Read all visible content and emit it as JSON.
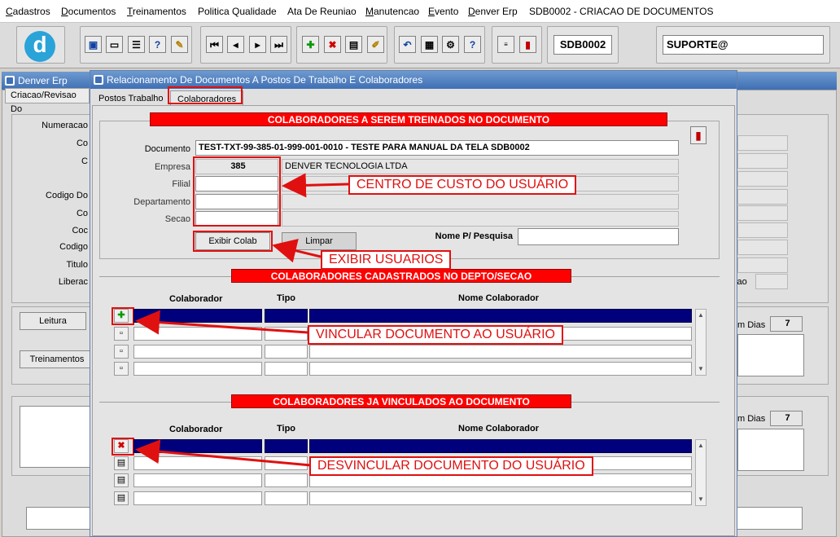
{
  "menu": [
    {
      "u": "C",
      "rest": "adastros"
    },
    {
      "u": "D",
      "rest": "ocumentos"
    },
    {
      "u": "T",
      "rest": "reinamentos"
    },
    {
      "u": "",
      "rest": "Politica Qualidade"
    },
    {
      "u": "",
      "rest": "Ata De Reuniao"
    },
    {
      "u": "M",
      "rest": "anutencao"
    },
    {
      "u": "E",
      "rest": "vento"
    },
    {
      "u": "D",
      "rest": "enver Erp"
    },
    {
      "u": "",
      "rest": "SDB0002 - CRIACAO DE DOCUMENTOS"
    }
  ],
  "toolbar": {
    "program": "SDB0002",
    "user": "SUPORTE@",
    "logo_letter": "d"
  },
  "back_window": {
    "title": "Denver Erp",
    "tab": "Criacao/Revisao Do",
    "labels": [
      "Numeracao",
      "Co",
      "C",
      "",
      "Codigo Do",
      "Co",
      "Coc",
      "Codigo",
      "Titulo",
      "Liberac"
    ],
    "btn_leitura": "Leitura",
    "btn_treinamentos": "Treinamentos",
    "right_lbl1": "m Dias",
    "right_val1": "7",
    "right_lbl2": "m Dias",
    "right_val2": "7",
    "right_lbl_sao": "sao"
  },
  "dialog": {
    "title": "Relacionamento De Documentos A Postos De Trabalho E Colaboradores",
    "tabs": [
      "Postos Trabalho",
      "Colaboradores"
    ],
    "banner1": "COLABORADORES A SEREM TREINADOS NO DOCUMENTO",
    "banner2": "COLABORADORES CADASTRADOS NO DEPTO/SECAO",
    "banner3": "COLABORADORES JA VINCULADOS AO DOCUMENTO",
    "documento_label": "Documento",
    "documento_value": "TEST-TXT-99-385-01-999-001-0010 - TESTE PARA MANUAL DA TELA SDB0002",
    "empresa_label": "Empresa",
    "empresa_code": "385",
    "empresa_name": "DENVER TECNOLOGIA LTDA",
    "filial_label": "Filial",
    "departamento_label": "Departamento",
    "secao_label": "Secao",
    "btn_exibir": "Exibir Colab",
    "btn_limpar": "Limpar",
    "nome_pesquisa_label": "Nome P/ Pesquisa",
    "col_colaborador": "Colaborador",
    "col_tipo": "Tipo",
    "col_nome": "Nome Colaborador"
  },
  "annotations": {
    "centro_custo": "CENTRO DE CUSTO DO USUÁRIO",
    "exibir_usuarios": "EXIBIR USUARIOS",
    "vincular": "VINCULAR DOCUMENTO AO USUÁRIO",
    "desvincular": "DESVINCULAR DOCUMENTO DO USUÁRIO"
  },
  "colors": {
    "accent": "#ff0000",
    "selection": "#00007c",
    "title_bar": "#3f6fb4"
  }
}
